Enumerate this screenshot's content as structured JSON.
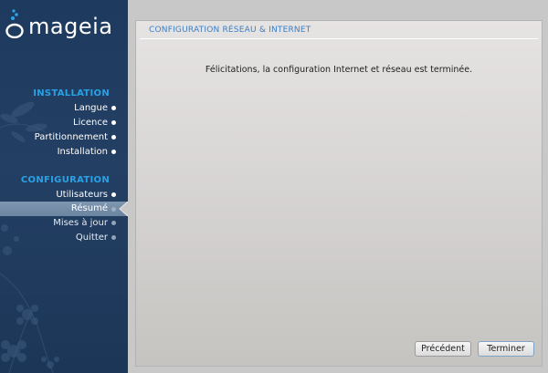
{
  "brand": {
    "logo_text": "mageia"
  },
  "sidebar": {
    "installation": {
      "title": "INSTALLATION",
      "steps": [
        {
          "label": "Langue"
        },
        {
          "label": "Licence"
        },
        {
          "label": "Partitionnement"
        },
        {
          "label": "Installation"
        }
      ]
    },
    "configuration": {
      "title": "CONFIGURATION",
      "steps": [
        {
          "label": "Utilisateurs"
        },
        {
          "label": "Résumé"
        },
        {
          "label": "Mises à jour"
        },
        {
          "label": "Quitter"
        }
      ]
    },
    "active_step": "Résumé"
  },
  "main": {
    "title": "CONFIGURATION RÉSEAU & INTERNET",
    "message": "Félicitations, la configuration Internet et réseau est terminée.",
    "buttons": {
      "previous": "Précédent",
      "finish": "Terminer"
    }
  },
  "colors": {
    "sidebar_bg": "#1e3a5e",
    "section_title": "#29a1e6",
    "page_title": "#3d7fc4",
    "active_step_bg": "#7390ab"
  }
}
